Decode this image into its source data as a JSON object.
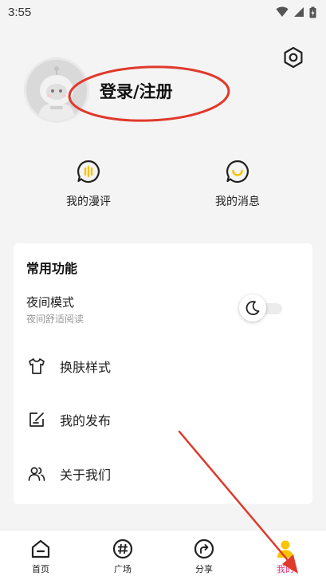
{
  "status": {
    "time": "3:55"
  },
  "profile": {
    "login_label": "登录/注册"
  },
  "quick_links": [
    {
      "label": "我的漫评",
      "icon": "comment-icon"
    },
    {
      "label": "我的消息",
      "icon": "message-icon"
    }
  ],
  "common": {
    "title": "常用功能",
    "night_mode": {
      "label": "夜间模式",
      "sub": "夜间舒适阅读",
      "enabled": false
    },
    "items": [
      {
        "label": "换肤样式",
        "icon": "shirt-icon"
      },
      {
        "label": "我的发布",
        "icon": "edit-icon"
      },
      {
        "label": "关于我们",
        "icon": "people-icon"
      }
    ]
  },
  "tabs": [
    {
      "label": "首页",
      "icon": "home-icon"
    },
    {
      "label": "广场",
      "icon": "hashtag-icon"
    },
    {
      "label": "分享",
      "icon": "share-icon"
    },
    {
      "label": "我的",
      "icon": "user-icon",
      "active": true
    }
  ],
  "colors": {
    "accent": "#f7c400",
    "active_tab": "#e6317c",
    "annotation": "#e0392b"
  }
}
